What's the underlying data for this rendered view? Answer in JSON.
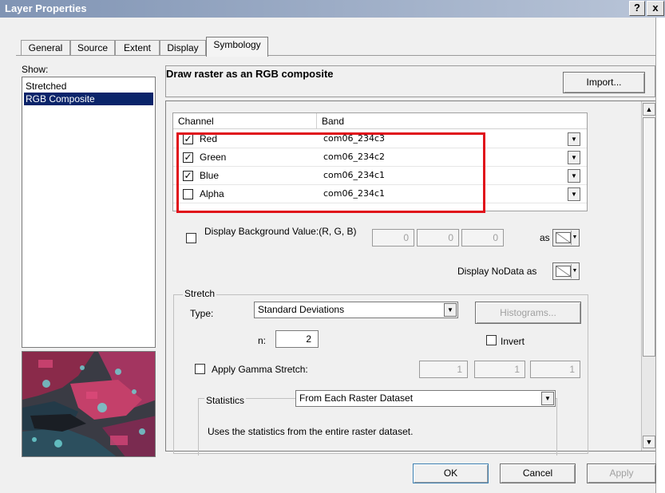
{
  "window": {
    "title": "Layer Properties",
    "help_label": "?",
    "close_label": "x"
  },
  "tabs": [
    {
      "label": "General"
    },
    {
      "label": "Source"
    },
    {
      "label": "Extent"
    },
    {
      "label": "Display"
    },
    {
      "label": "Symbology",
      "active": true
    }
  ],
  "show": {
    "label": "Show:",
    "items": [
      {
        "label": "Stretched"
      },
      {
        "label": "RGB Composite",
        "selected": true
      }
    ]
  },
  "header": {
    "title": "Draw raster as an RGB composite",
    "import_label": "Import..."
  },
  "channel_grid": {
    "col_channel": "Channel",
    "col_band": "Band",
    "rows": [
      {
        "channel": "Red",
        "checked": true,
        "band": "com06_234c3"
      },
      {
        "channel": "Green",
        "checked": true,
        "band": "com06_234c2"
      },
      {
        "channel": "Blue",
        "checked": true,
        "band": "com06_234c1"
      },
      {
        "channel": "Alpha",
        "checked": false,
        "band": "com06_234c1"
      }
    ],
    "highlight_color": "#e0101a"
  },
  "background": {
    "label": "Display Background Value:(R, G, B)",
    "values": [
      "0",
      "0",
      "0"
    ],
    "as_label": "as"
  },
  "nodata": {
    "label": "Display NoData as"
  },
  "stretch": {
    "legend": "Stretch",
    "type_label": "Type:",
    "type_value": "Standard Deviations",
    "histograms_label": "Histograms...",
    "n_label": "n:",
    "n_value": "2",
    "invert_label": "Invert",
    "gamma_label": "Apply Gamma Stretch:",
    "gamma_values": [
      "1",
      "1",
      "1"
    ]
  },
  "statistics": {
    "legend": "Statistics",
    "value": "From Each Raster Dataset",
    "description": "Uses the statistics from the entire raster dataset."
  },
  "buttons": {
    "ok": "OK",
    "cancel": "Cancel",
    "apply": "Apply"
  }
}
